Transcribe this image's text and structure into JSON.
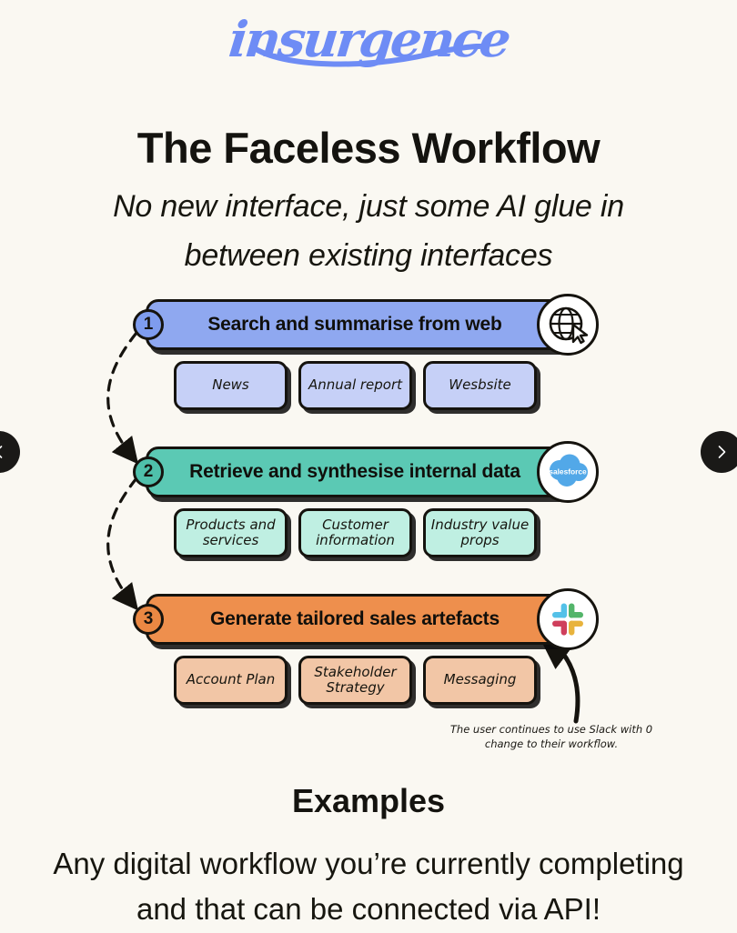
{
  "brand": {
    "logo_text": "insurgence",
    "logo_color": "#6E8CF5"
  },
  "header": {
    "title": "The Faceless Workflow",
    "subtitle": "No new interface, just some AI glue in between existing interfaces"
  },
  "colors": {
    "background": "#FAF8F2",
    "step1_bar": "#8FA8F0",
    "step1_chip": "#C6D0F7",
    "step2_bar": "#5BC9B4",
    "step2_chip": "#BFEFE2",
    "step3_bar": "#EE8F4D",
    "step3_chip": "#F2C6A6",
    "outline": "#15130E",
    "salesforce_blue": "#52A8E8",
    "slack_blue": "#54C1E8",
    "slack_green": "#53B56A",
    "slack_red": "#CF3F5C",
    "slack_yellow": "#E8B33C"
  },
  "flow": {
    "steps": [
      {
        "number": "1",
        "label": "Search and summarise from web",
        "icon": "globe-cursor-icon",
        "chips": [
          "News",
          "Annual report",
          "Wesbsite"
        ]
      },
      {
        "number": "2",
        "label": "Retrieve and synthesise internal data",
        "icon": "salesforce-icon",
        "icon_text": "salesforce",
        "chips": [
          "Products and services",
          "Customer information",
          "Industry value props"
        ]
      },
      {
        "number": "3",
        "label": "Generate tailored sales artefacts",
        "icon": "slack-icon",
        "chips": [
          "Account Plan",
          "Stakeholder Strategy",
          "Messaging"
        ]
      }
    ],
    "annotation": "The user continues to use Slack with 0 change to their workflow."
  },
  "footer": {
    "heading": "Examples",
    "body": "Any digital workflow you’re currently completing and that can be connected via API!"
  },
  "carousel": {
    "prev_label": "‹",
    "next_label": "›"
  }
}
